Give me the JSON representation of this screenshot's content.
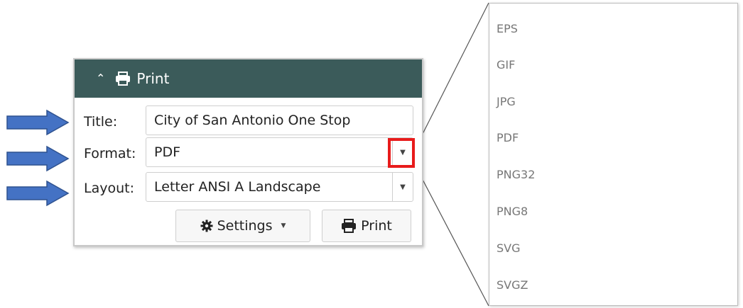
{
  "panel": {
    "header_title": "Print",
    "title_label": "Title:",
    "title_value": "City of San Antonio One Stop",
    "format_label": "Format:",
    "format_value": "PDF",
    "layout_label": "Layout:",
    "layout_value": "Letter ANSI A Landscape",
    "settings_button": "Settings",
    "print_button": "Print"
  },
  "format_options": [
    "EPS",
    "GIF",
    "JPG",
    "PDF",
    "PNG32",
    "PNG8",
    "SVG",
    "SVGZ"
  ],
  "colors": {
    "header_bg": "#3b5b5a",
    "arrow": "#4472c4",
    "highlight": "#e81b1b"
  }
}
